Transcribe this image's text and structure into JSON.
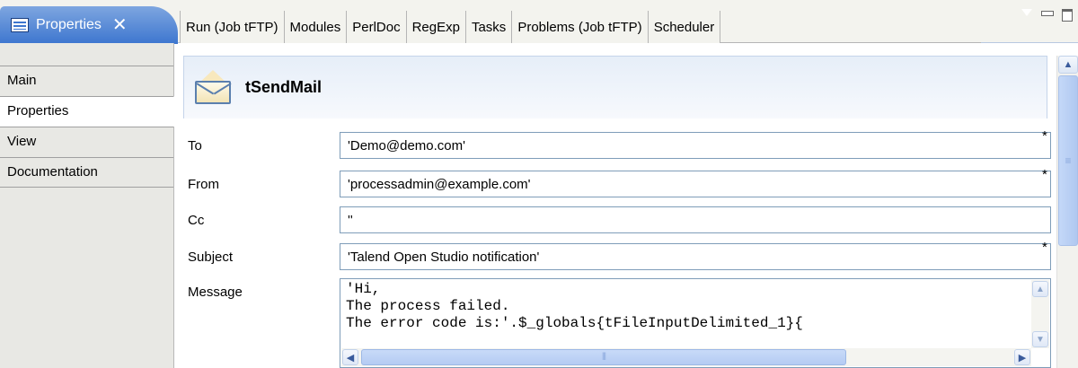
{
  "view_tab": {
    "label": "Properties",
    "close": "✕"
  },
  "tabs": [
    "Run (Job tFTP)",
    "Modules",
    "PerlDoc",
    "RegExp",
    "Tasks",
    "Problems (Job tFTP)",
    "Scheduler"
  ],
  "sidebar": {
    "items": [
      "Main",
      "Properties",
      "View",
      "Documentation"
    ],
    "selected": "Properties"
  },
  "component": {
    "name": "tSendMail",
    "icon": "envelope-icon"
  },
  "fields": {
    "to": {
      "label": "To",
      "value": "'Demo@demo.com'",
      "required": "*"
    },
    "from": {
      "label": "From",
      "value": "'processadmin@example.com'",
      "required": "*"
    },
    "cc": {
      "label": "Cc",
      "value": "''"
    },
    "subject": {
      "label": "Subject",
      "value": "'Talend Open Studio notification'",
      "required": "*"
    },
    "message": {
      "label": "Message",
      "value": "'Hi,\nThe process failed.\nThe error code is:'.$_globals{tFileInputDelimited_1}{"
    }
  },
  "colors": {
    "active_tab": "#3d76cf",
    "header_bg": "#e6eef8",
    "input_border": "#7f9db9"
  }
}
